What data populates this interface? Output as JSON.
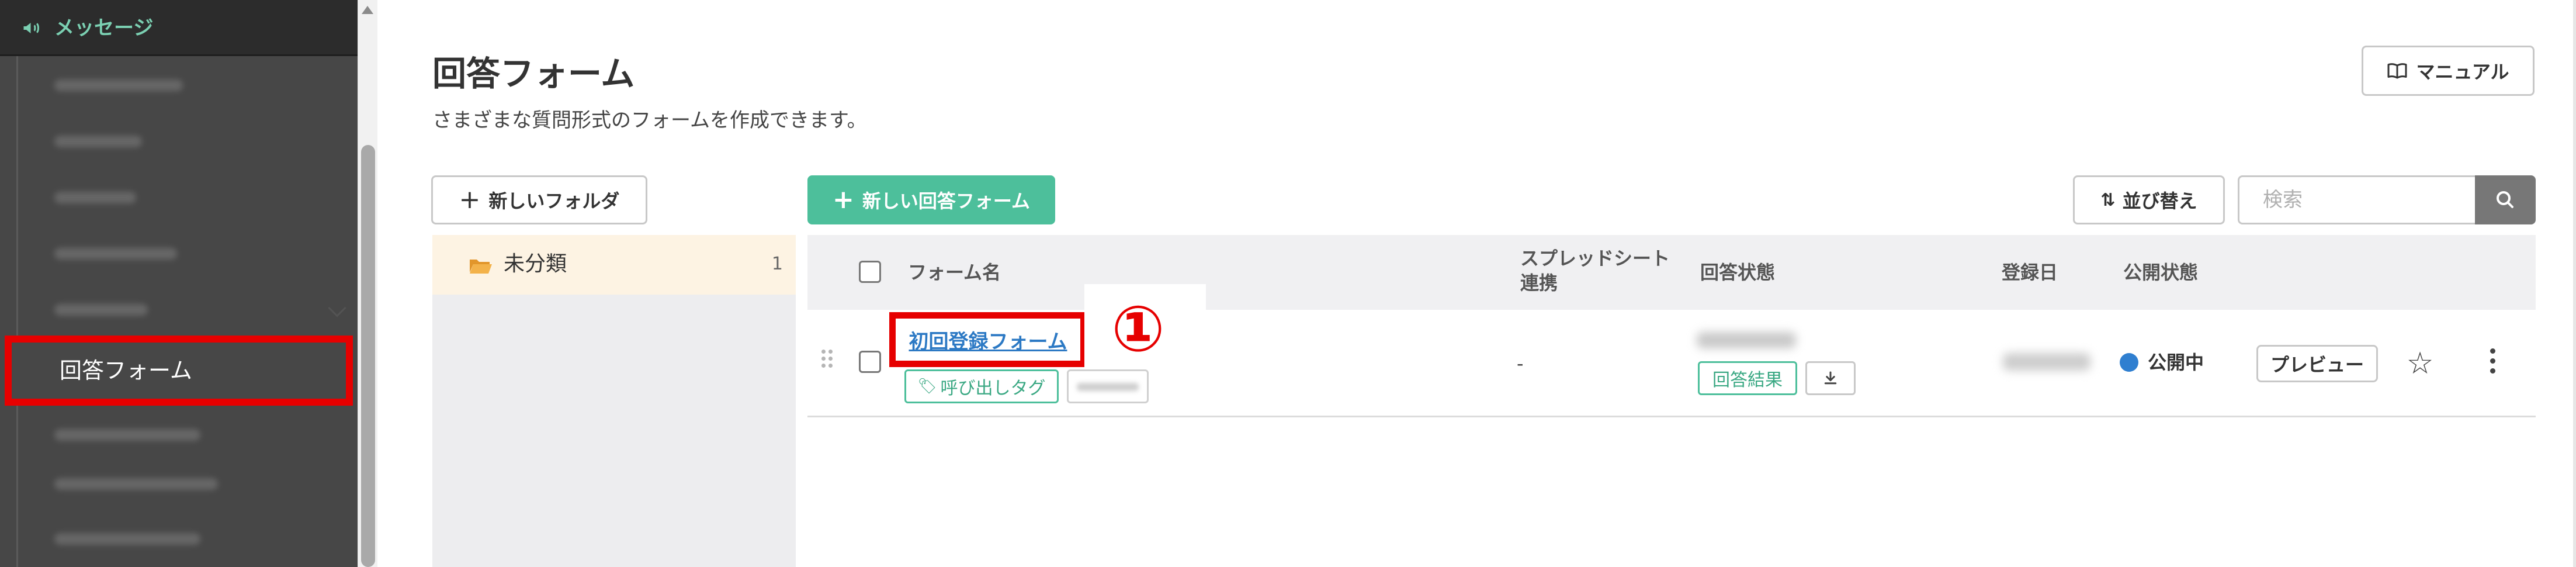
{
  "sidebar": {
    "header_label": "メッセージ",
    "active_item_label": "回答フォーム"
  },
  "page": {
    "title": "回答フォーム",
    "subtitle": "さまざまな質問形式のフォームを作成できます。",
    "manual_label": "マニュアル"
  },
  "toolbar": {
    "new_folder_label": "新しいフォルダ",
    "new_form_label": "新しい回答フォーム",
    "sort_label": "並び替え",
    "search_placeholder": "検索"
  },
  "folders": [
    {
      "name": "未分類",
      "count": "1"
    }
  ],
  "table": {
    "headers": {
      "form_name": "フォーム名",
      "spreadsheet_line1": "スプレッドシート",
      "spreadsheet_line2": "連携",
      "answer_status": "回答状態",
      "registered_date": "登録日",
      "publish_status": "公開状態"
    },
    "rows": [
      {
        "form_name": "初回登録フォーム",
        "call_tag_label": "呼び出しタグ",
        "spreadsheet": "-",
        "result_label": "回答結果",
        "publish_status": "公開中",
        "preview_label": "プレビュー"
      }
    ]
  },
  "annotation": {
    "callout_number": "①",
    "highlight_color": "#e60000"
  },
  "colors": {
    "accent": "#4dbf9b",
    "link": "#2c79c4",
    "status_dot": "#2f7fd0"
  },
  "icons": [
    "megaphone-icon",
    "book-icon",
    "plus-icon",
    "sort-icon",
    "search-icon",
    "folder-open-icon",
    "drag-handle-icon",
    "tag-icon",
    "download-icon",
    "star-icon",
    "more-vertical-icon"
  ]
}
